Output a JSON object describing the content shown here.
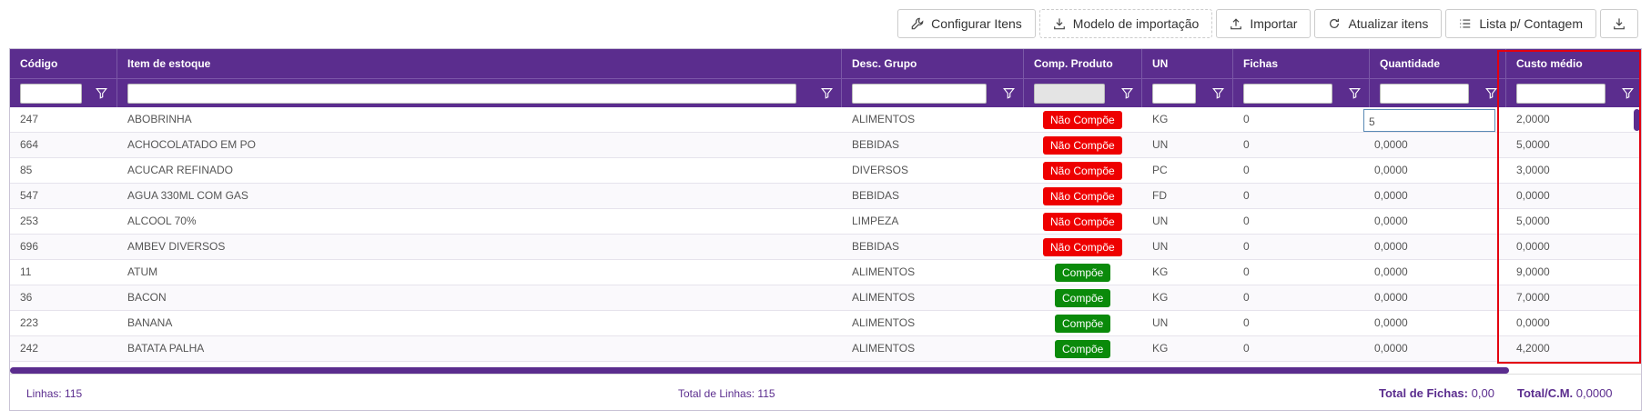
{
  "toolbar": {
    "configurar": "Configurar Itens",
    "modelo": "Modelo de importação",
    "importar": "Importar",
    "atualizar": "Atualizar itens",
    "lista": "Lista p/ Contagem"
  },
  "columns": [
    "Código",
    "Item de estoque",
    "Desc. Grupo",
    "Comp. Produto",
    "UN",
    "Fichas",
    "Quantidade",
    "Custo médio"
  ],
  "rows": [
    {
      "codigo": "247",
      "item": "ABOBRINHA",
      "grupo": "ALIMENTOS",
      "comp": "Não Compõe",
      "un": "KG",
      "fichas": "0",
      "qtd": "5",
      "custo": "2,0000"
    },
    {
      "codigo": "664",
      "item": "ACHOCOLATADO EM PO",
      "grupo": "BEBIDAS",
      "comp": "Não Compõe",
      "un": "UN",
      "fichas": "0",
      "qtd": "0,0000",
      "custo": "5,0000"
    },
    {
      "codigo": "85",
      "item": "ACUCAR REFINADO",
      "grupo": "DIVERSOS",
      "comp": "Não Compõe",
      "un": "PC",
      "fichas": "0",
      "qtd": "0,0000",
      "custo": "3,0000"
    },
    {
      "codigo": "547",
      "item": "AGUA 330ML COM GAS",
      "grupo": "BEBIDAS",
      "comp": "Não Compõe",
      "un": "FD",
      "fichas": "0",
      "qtd": "0,0000",
      "custo": "0,0000"
    },
    {
      "codigo": "253",
      "item": "ALCOOL 70%",
      "grupo": "LIMPEZA",
      "comp": "Não Compõe",
      "un": "UN",
      "fichas": "0",
      "qtd": "0,0000",
      "custo": "5,0000"
    },
    {
      "codigo": "696",
      "item": "AMBEV DIVERSOS",
      "grupo": "BEBIDAS",
      "comp": "Não Compõe",
      "un": "UN",
      "fichas": "0",
      "qtd": "0,0000",
      "custo": "0,0000"
    },
    {
      "codigo": "11",
      "item": "ATUM",
      "grupo": "ALIMENTOS",
      "comp": "Compõe",
      "un": "KG",
      "fichas": "0",
      "qtd": "0,0000",
      "custo": "9,0000"
    },
    {
      "codigo": "36",
      "item": "BACON",
      "grupo": "ALIMENTOS",
      "comp": "Compõe",
      "un": "KG",
      "fichas": "0",
      "qtd": "0,0000",
      "custo": "7,0000"
    },
    {
      "codigo": "223",
      "item": "BANANA",
      "grupo": "ALIMENTOS",
      "comp": "Compõe",
      "un": "UN",
      "fichas": "0",
      "qtd": "0,0000",
      "custo": "0,0000"
    },
    {
      "codigo": "242",
      "item": "BATATA PALHA",
      "grupo": "ALIMENTOS",
      "comp": "Compõe",
      "un": "KG",
      "fichas": "0",
      "qtd": "0,0000",
      "custo": "4,2000"
    }
  ],
  "footer": {
    "linhas_label": "Linhas:",
    "linhas_value": "115",
    "total_linhas_label": "Total de Linhas:",
    "total_linhas_value": "115",
    "total_fichas_label": "Total de Fichas:",
    "total_fichas_value": "0,00",
    "total_cm_label": "Total/C.M.",
    "total_cm_value": "0,0000"
  },
  "colors": {
    "header": "#5b2d8e",
    "nao_compoe": "#ee0000",
    "compoe": "#0a8a0a",
    "highlight": "#e3000f"
  }
}
